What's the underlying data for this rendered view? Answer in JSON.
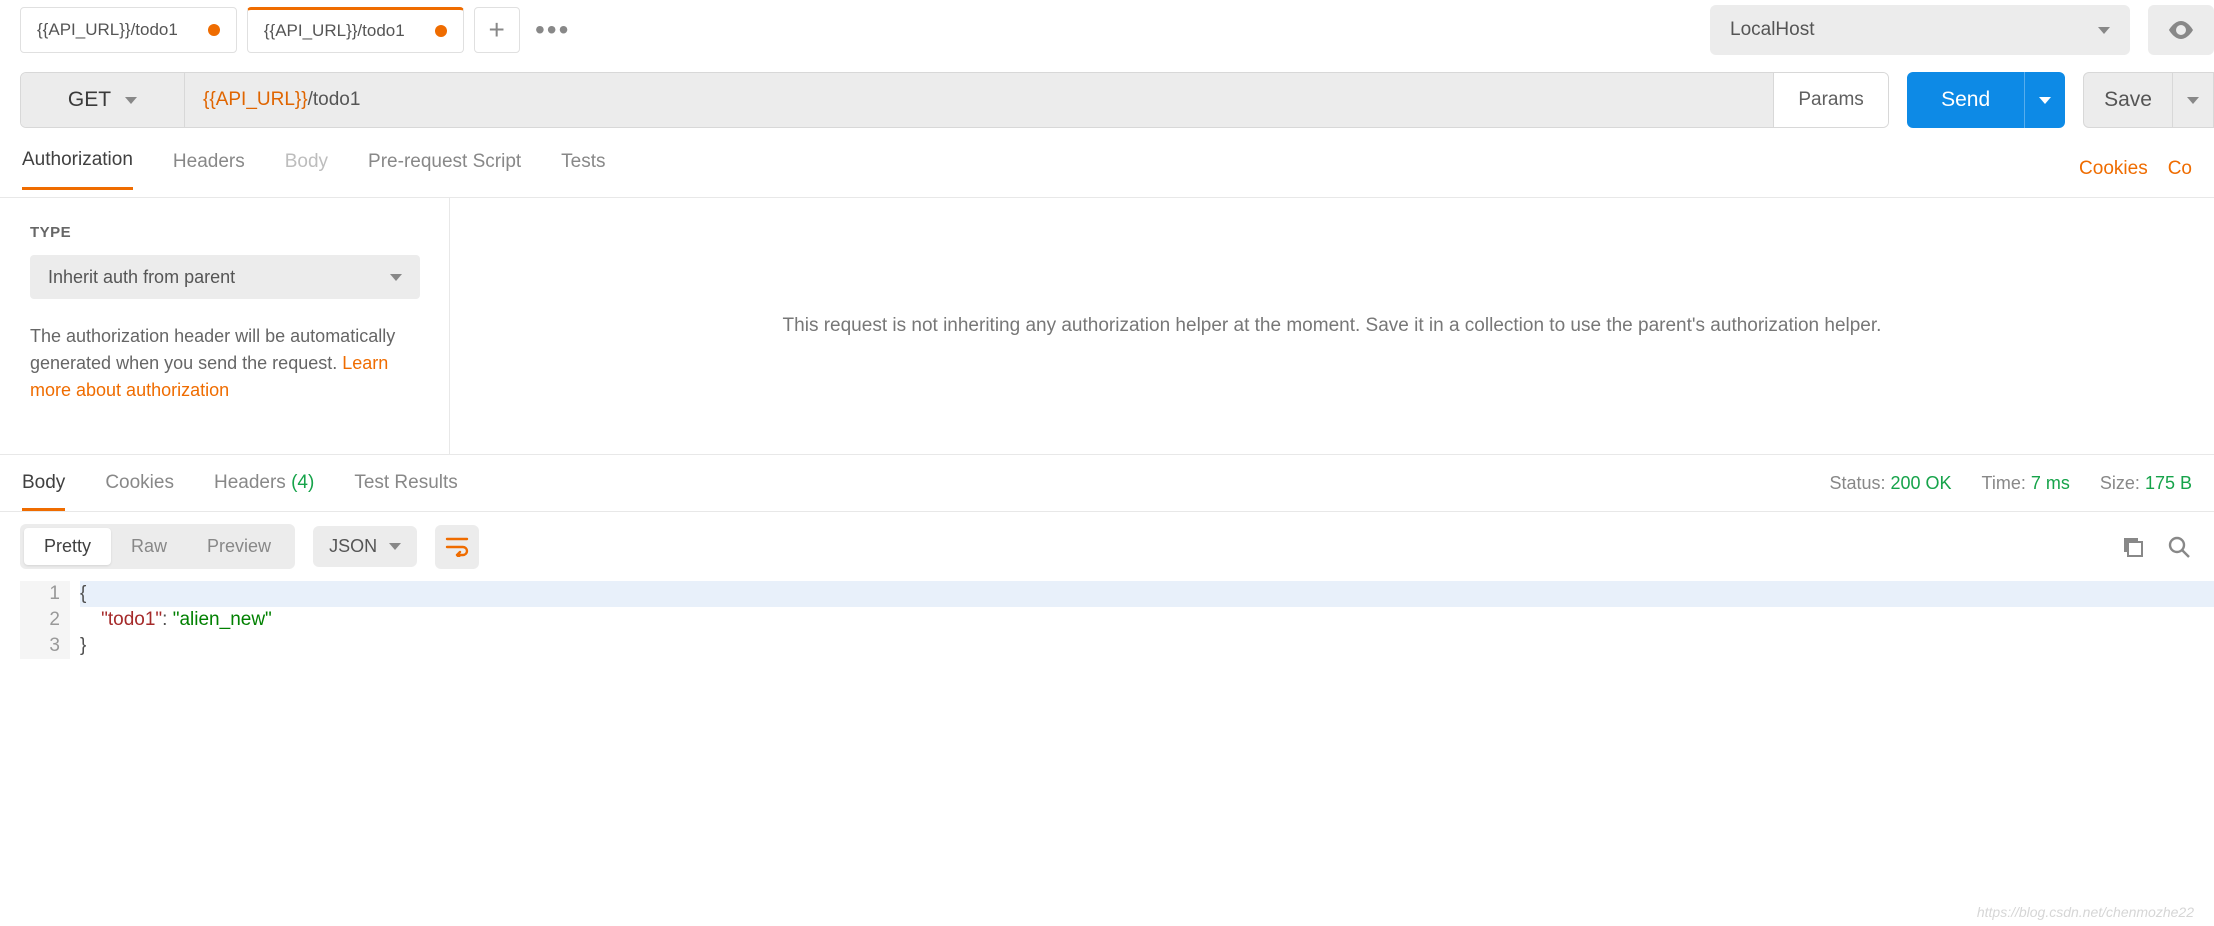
{
  "tabs": [
    {
      "label": "{{API_URL}}/todo1",
      "dirty": true,
      "active": false
    },
    {
      "label": "{{API_URL}}/todo1",
      "dirty": true,
      "active": true
    }
  ],
  "environment": {
    "selected": "LocalHost"
  },
  "request": {
    "method": "GET",
    "url_variable": "{{API_URL}}",
    "url_path": "/todo1",
    "params_label": "Params",
    "send_label": "Send",
    "save_label": "Save"
  },
  "request_tabs": {
    "authorization": "Authorization",
    "headers": "Headers",
    "body": "Body",
    "prerequest": "Pre-request Script",
    "tests": "Tests",
    "cookies_link": "Cookies",
    "code_link": "Co"
  },
  "auth": {
    "type_label": "TYPE",
    "selected": "Inherit auth from parent",
    "description_prefix": "The authorization header will be automatically generated when you send the request. ",
    "learn_more": "Learn more about authorization",
    "right_message": "This request is not inheriting any authorization helper at the moment. Save it in a collection to use the parent's authorization helper."
  },
  "response_tabs": {
    "body": "Body",
    "cookies": "Cookies",
    "headers": "Headers",
    "headers_count": "(4)",
    "test_results": "Test Results"
  },
  "response_status": {
    "status_label": "Status:",
    "status_value": "200 OK",
    "time_label": "Time:",
    "time_value": "7 ms",
    "size_label": "Size:",
    "size_value": "175 B"
  },
  "body_view": {
    "pretty": "Pretty",
    "raw": "Raw",
    "preview": "Preview",
    "format": "JSON"
  },
  "response_body": {
    "line1": "{",
    "line2_key": "\"todo1\"",
    "line2_sep": ": ",
    "line2_val": "\"alien_new\"",
    "line3": "}"
  },
  "line_numbers": [
    "1",
    "2",
    "3"
  ],
  "watermark": "https://blog.csdn.net/chenmozhe22"
}
